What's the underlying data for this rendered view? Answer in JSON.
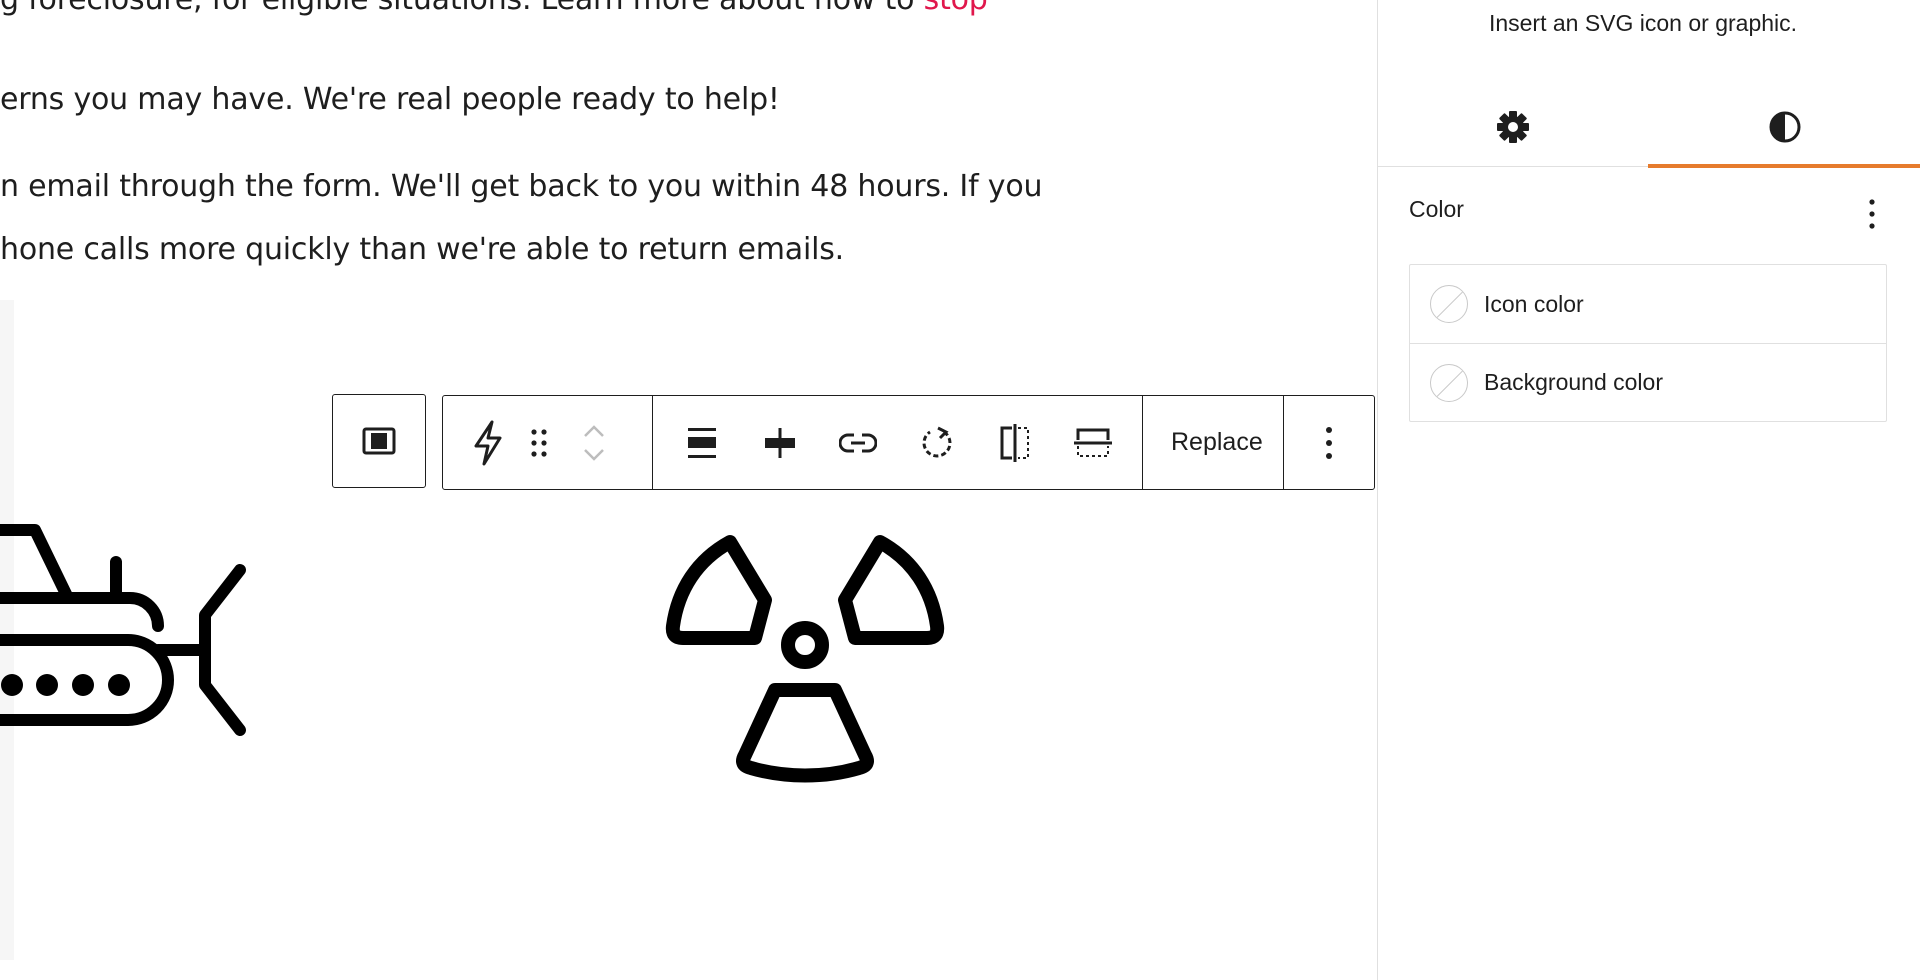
{
  "content": {
    "line1_text": "g foreclosure, for eligible situations. Learn more about how to ",
    "line1_link": "stop",
    "line2": "erns you may have. We're real people ready to help!",
    "line3": "n email through the form. We'll get back to you within 48 hours. If you",
    "line4": "hone calls more quickly than we're able to return emails."
  },
  "toolbar": {
    "replace_label": "Replace",
    "icons": [
      "parent-block-icon",
      "lightning-icon",
      "drag-handle-icon",
      "move-up-icon",
      "move-down-icon",
      "justify-icon",
      "align-center-icon",
      "link-icon",
      "rotate-icon",
      "flip-horizontal-icon",
      "flip-vertical-icon",
      "more-options-icon"
    ]
  },
  "canvas_icons": [
    "bulldozer-icon",
    "radiation-icon"
  ],
  "sidebar": {
    "description": "Insert an SVG icon or graphic.",
    "tabs": [
      "settings",
      "styles"
    ],
    "color_section": {
      "title": "Color",
      "items": [
        {
          "label": "Icon color"
        },
        {
          "label": "Background color"
        }
      ]
    }
  },
  "colors": {
    "link": "#e0174c",
    "accent": "#e67b2d",
    "border": "#e0e0e0"
  }
}
